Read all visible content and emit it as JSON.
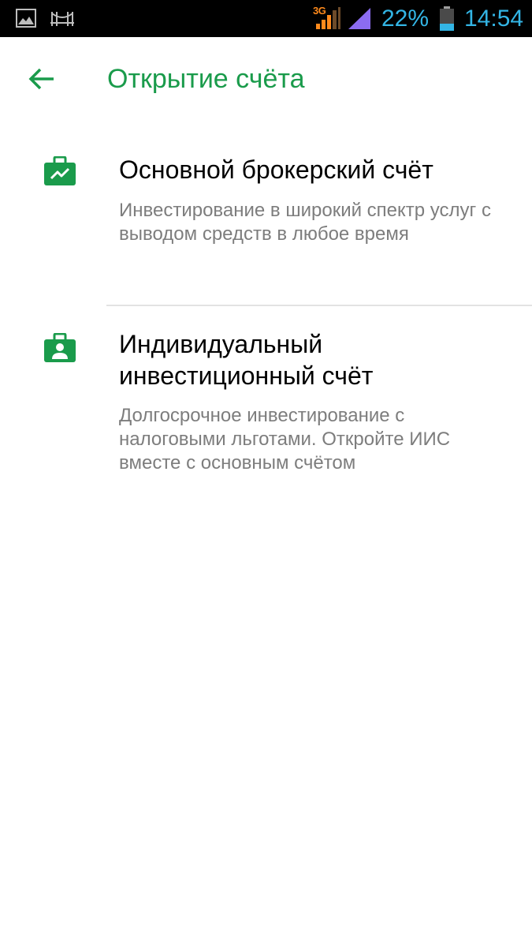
{
  "status_bar": {
    "network_type": "3G",
    "battery_percent": "22%",
    "time": "14:54",
    "icons": [
      "gallery-icon",
      "bridge-icon",
      "signal-icon",
      "signal-icon",
      "battery-icon"
    ],
    "colors": {
      "text": "#33b5e5",
      "signal_sim1": "#ff8a1c",
      "signal_sim2": "#8b6cf0",
      "background": "#000000"
    }
  },
  "app_bar": {
    "title": "Открытие счёта",
    "back_icon": "arrow-back-icon",
    "accent_color": "#1a9b4b"
  },
  "options": [
    {
      "icon": "briefcase-chart-icon",
      "title": "Основной брокерский счёт",
      "description": "Инвестирование в широкий спектр услуг с выводом средств в любое время"
    },
    {
      "icon": "briefcase-person-icon",
      "title": "Индивидуальный инвестиционный счёт",
      "description": "Долгосрочное инвестирование с налоговыми льготами. Откройте ИИС вместе с основным счётом"
    }
  ]
}
